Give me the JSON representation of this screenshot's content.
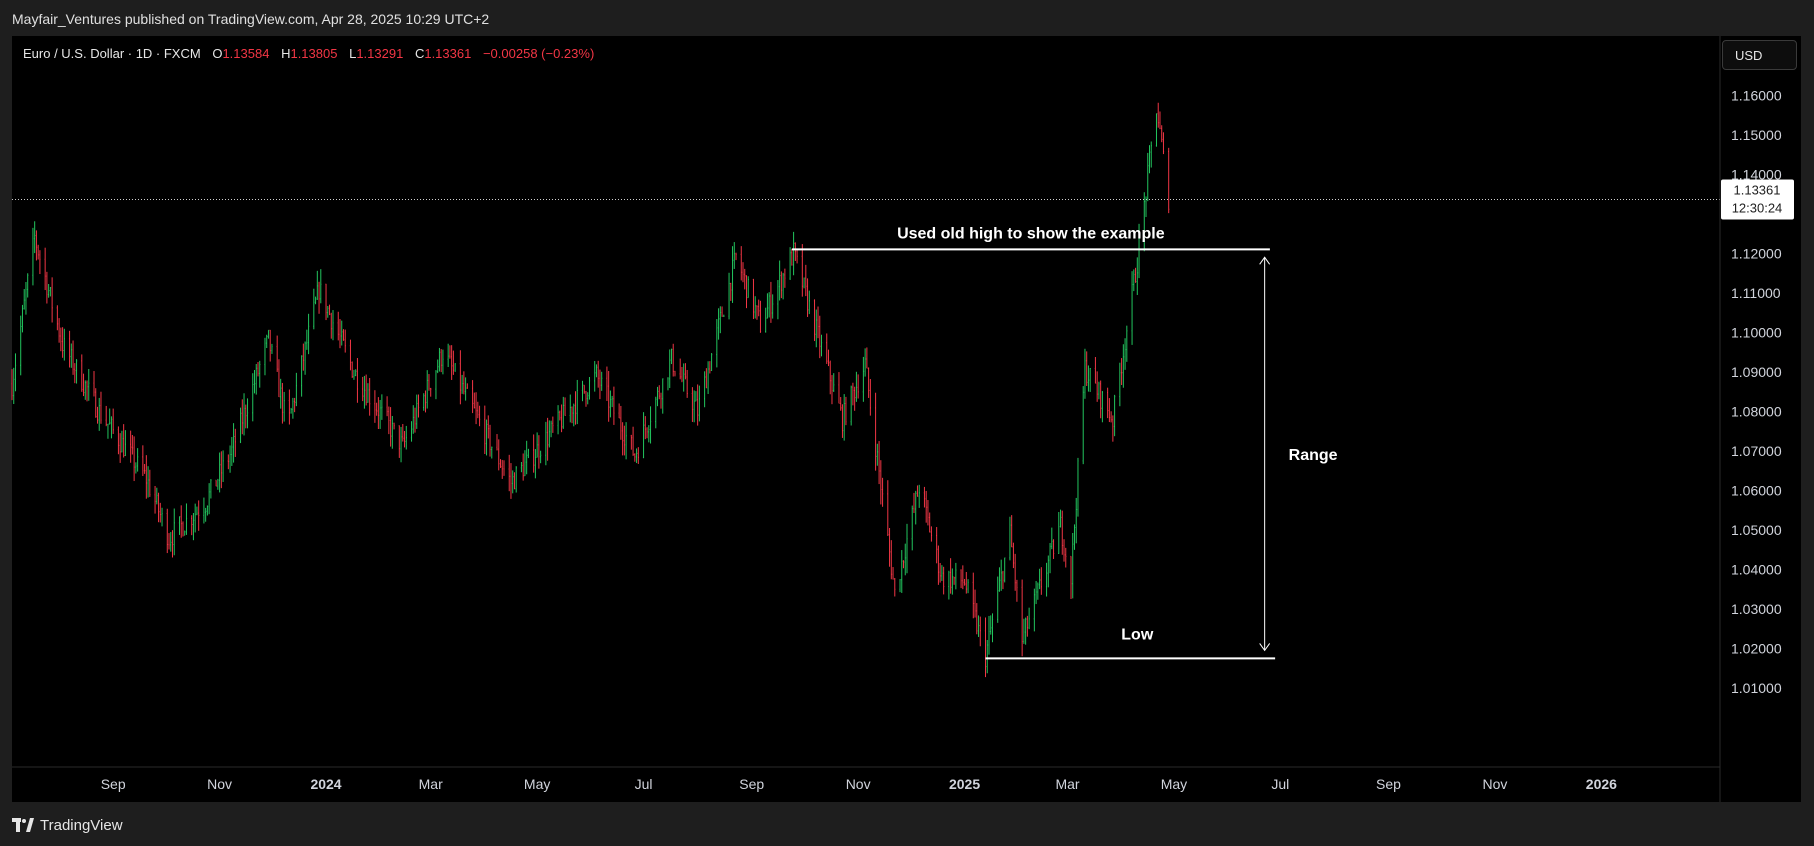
{
  "header": {
    "publisher": "Mayfair_Ventures published on TradingView.com, Apr 28, 2025 10:29 UTC+2"
  },
  "legend": {
    "symbol": "Euro / U.S. Dollar · 1D · FXCM",
    "open_label": "O",
    "open": "1.13584",
    "high_label": "H",
    "high": "1.13805",
    "low_label": "L",
    "low": "1.13291",
    "close_label": "C",
    "close": "1.13361",
    "change": "−0.00258 (−0.23%)"
  },
  "currency_button": "USD",
  "price_tag": {
    "price": "1.13361",
    "countdown": "12:30:24"
  },
  "footer": {
    "brand": "TradingView"
  },
  "colors": {
    "up": "#26a69a",
    "up_bright": "#22c55e",
    "down": "#f23645",
    "background": "#000000"
  },
  "chart_data": {
    "type": "ohlc",
    "interval": "1D",
    "y_axis": {
      "ticks": [
        "1.16000",
        "1.15000",
        "1.14000",
        "1.12000",
        "1.11000",
        "1.10000",
        "1.09000",
        "1.08000",
        "1.07000",
        "1.06000",
        "1.05000",
        "1.04000",
        "1.03000",
        "1.02000",
        "1.01000"
      ],
      "range": [
        0.99,
        1.175
      ]
    },
    "x_axis": {
      "ticks": [
        {
          "label": "Sep",
          "date": "2023-09-01",
          "bold": false
        },
        {
          "label": "Nov",
          "date": "2023-11-01",
          "bold": false
        },
        {
          "label": "2024",
          "date": "2024-01-01",
          "bold": true
        },
        {
          "label": "Mar",
          "date": "2024-03-01",
          "bold": false
        },
        {
          "label": "May",
          "date": "2024-05-01",
          "bold": false
        },
        {
          "label": "Jul",
          "date": "2024-07-01",
          "bold": false
        },
        {
          "label": "Sep",
          "date": "2024-09-01",
          "bold": false
        },
        {
          "label": "Nov",
          "date": "2024-11-01",
          "bold": false
        },
        {
          "label": "2025",
          "date": "2025-01-01",
          "bold": true
        },
        {
          "label": "Mar",
          "date": "2025-03-01",
          "bold": false
        },
        {
          "label": "May",
          "date": "2025-05-01",
          "bold": false
        },
        {
          "label": "Jul",
          "date": "2025-07-01",
          "bold": false
        },
        {
          "label": "Sep",
          "date": "2025-09-01",
          "bold": false
        },
        {
          "label": "Nov",
          "date": "2025-11-01",
          "bold": false
        },
        {
          "label": "2026",
          "date": "2026-01-01",
          "bold": true
        }
      ],
      "range": [
        "2023-07-05",
        "2026-03-10"
      ]
    },
    "price_path": [
      {
        "date": "2023-07-05",
        "value": 1.087
      },
      {
        "date": "2023-07-18",
        "value": 1.124
      },
      {
        "date": "2023-08-03",
        "value": 1.097
      },
      {
        "date": "2023-08-24",
        "value": 1.08
      },
      {
        "date": "2023-09-20",
        "value": 1.063
      },
      {
        "date": "2023-10-03",
        "value": 1.048
      },
      {
        "date": "2023-10-24",
        "value": 1.057
      },
      {
        "date": "2023-11-08",
        "value": 1.07
      },
      {
        "date": "2023-11-29",
        "value": 1.098
      },
      {
        "date": "2023-12-10",
        "value": 1.076
      },
      {
        "date": "2023-12-28",
        "value": 1.111
      },
      {
        "date": "2024-01-17",
        "value": 1.09
      },
      {
        "date": "2024-02-14",
        "value": 1.071
      },
      {
        "date": "2024-03-08",
        "value": 1.095
      },
      {
        "date": "2024-04-16",
        "value": 1.062
      },
      {
        "date": "2024-06-04",
        "value": 1.089
      },
      {
        "date": "2024-06-26",
        "value": 1.069
      },
      {
        "date": "2024-07-17",
        "value": 1.093
      },
      {
        "date": "2024-08-01",
        "value": 1.08
      },
      {
        "date": "2024-08-23",
        "value": 1.119
      },
      {
        "date": "2024-09-06",
        "value": 1.102
      },
      {
        "date": "2024-09-25",
        "value": 1.12
      },
      {
        "date": "2024-10-23",
        "value": 1.078
      },
      {
        "date": "2024-11-05",
        "value": 1.092
      },
      {
        "date": "2024-11-22",
        "value": 1.034
      },
      {
        "date": "2024-12-06",
        "value": 1.061
      },
      {
        "date": "2024-12-19",
        "value": 1.038
      },
      {
        "date": "2025-01-01",
        "value": 1.037
      },
      {
        "date": "2025-01-13",
        "value": 1.018
      },
      {
        "date": "2025-01-27",
        "value": 1.049
      },
      {
        "date": "2025-02-03",
        "value": 1.022
      },
      {
        "date": "2025-02-25",
        "value": 1.051
      },
      {
        "date": "2025-03-03",
        "value": 1.038
      },
      {
        "date": "2025-03-11",
        "value": 1.091
      },
      {
        "date": "2025-03-27",
        "value": 1.078
      },
      {
        "date": "2025-04-10",
        "value": 1.118
      },
      {
        "date": "2025-04-21",
        "value": 1.157
      },
      {
        "date": "2025-04-28",
        "value": 1.134
      }
    ],
    "annotations": {
      "old_high": {
        "value": 1.121,
        "x_start": "2024-09-24",
        "x_end": "2025-06-25",
        "label": "Used old high to show the example"
      },
      "low": {
        "value": 1.0175,
        "x_start": "2025-01-13",
        "x_end": "2025-06-28",
        "label": "Low"
      },
      "range": {
        "from": 1.0195,
        "to": 1.119,
        "x": "2025-06-22",
        "label": "Range"
      },
      "last_price_line": 1.13361
    }
  }
}
